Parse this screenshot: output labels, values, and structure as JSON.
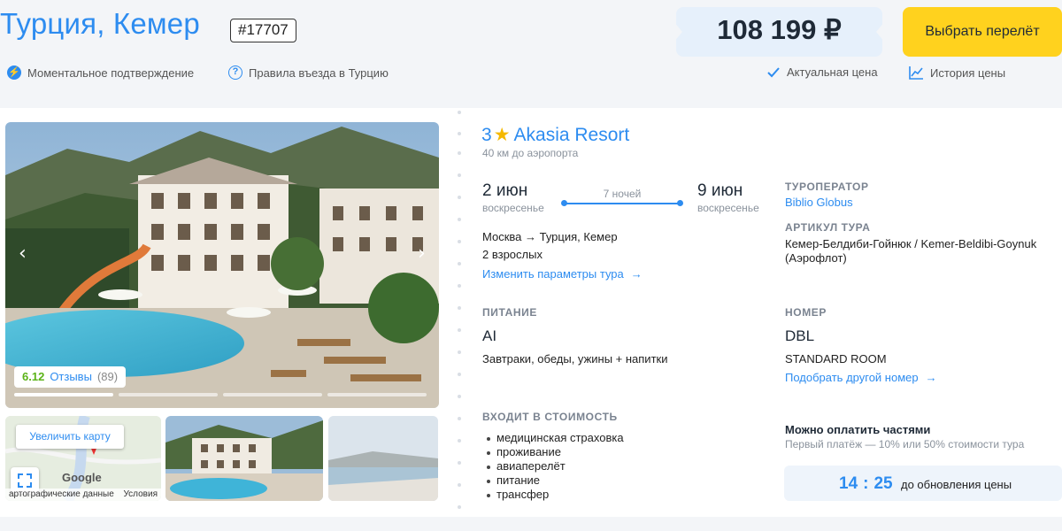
{
  "header": {
    "title": "Турция, Кемер",
    "tour_id": "#17707",
    "price": "108 199 ₽",
    "select_button": "Выбрать перелёт",
    "instant_confirmation": "Моментальное подтверждение",
    "entry_rules": "Правила въезда в Турцию",
    "actual_price": "Актуальная цена",
    "price_history": "История цены"
  },
  "gallery": {
    "rating": "6.12",
    "reviews_label": "Отзывы",
    "reviews_count": "(89)",
    "map_button": "Увеличить карту",
    "map_data": "артографические данные",
    "map_terms": "Условия",
    "google": "Google"
  },
  "hotel": {
    "stars": "3",
    "star_icon": "★",
    "name": "Akasia Resort",
    "airport_distance": "40 км до аэропорта"
  },
  "dates": {
    "start_date": "2 июн",
    "start_day": "воскресенье",
    "nights": "7 ночей",
    "end_date": "9 июн",
    "end_day": "воскресенье"
  },
  "route": {
    "direction": "Москва → Турция, Кемер",
    "guests": "2 взрослых",
    "change_params": "Изменить параметры тура",
    "arrow": "→"
  },
  "operator": {
    "label": "ТУРОПЕРАТОР",
    "name": "Biblio Globus",
    "article_label": "АРТИКУЛ ТУРА",
    "article": "Кемер-Белдиби-Гойнюк / Kemer-Beldibi-Goynuk (Аэрофлот)"
  },
  "meal": {
    "label": "ПИТАНИЕ",
    "code": "AI",
    "description": "Завтраки, обеды, ужины + напитки"
  },
  "room": {
    "label": "НОМЕР",
    "code": "DBL",
    "type": "STANDARD ROOM",
    "choose_other": "Подобрать другой номер",
    "arrow": "→"
  },
  "includes": {
    "label": "ВХОДИТ В СТОИМОСТЬ",
    "items": [
      "медицинская страховка",
      "проживание",
      "авиаперелёт",
      "питание",
      "трансфер"
    ]
  },
  "installments": {
    "title": "Можно оплатить частями",
    "subtitle": "Первый платёж — 10% или 50% стоимости тура"
  },
  "timer": {
    "minutes": "14",
    "seconds": "25",
    "separator": ":",
    "label": "до обновления цены"
  },
  "colors": {
    "accent": "#2d8cf0",
    "button": "#ffd21e",
    "rating_green": "#5bb318"
  }
}
